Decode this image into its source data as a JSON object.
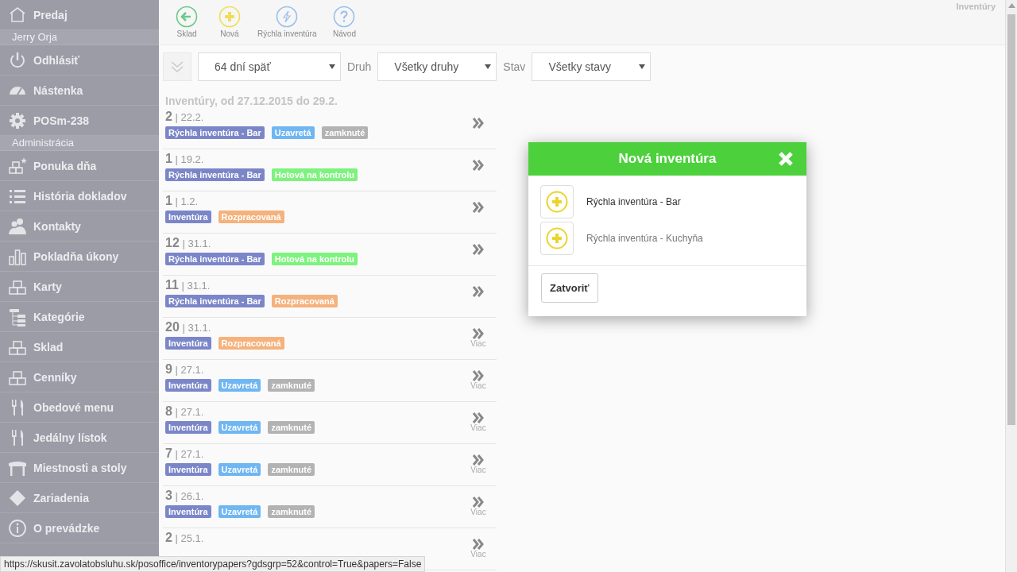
{
  "sidebar": {
    "items": [
      {
        "kind": "item",
        "label": "Predaj"
      },
      {
        "kind": "section",
        "label": "Jerry Orja"
      },
      {
        "kind": "item",
        "label": "Odhlásiť"
      },
      {
        "kind": "item",
        "label": "Nástenka"
      },
      {
        "kind": "item",
        "label": "POSm-238"
      },
      {
        "kind": "section",
        "label": "Administrácia"
      },
      {
        "kind": "item",
        "label": "Ponuka dňa"
      },
      {
        "kind": "item",
        "label": "História dokladov"
      },
      {
        "kind": "item",
        "label": "Kontakty"
      },
      {
        "kind": "item",
        "label": "Pokladňa úkony"
      },
      {
        "kind": "item",
        "label": "Karty"
      },
      {
        "kind": "item",
        "label": "Kategórie"
      },
      {
        "kind": "item",
        "label": "Sklad"
      },
      {
        "kind": "item",
        "label": "Cenníky"
      },
      {
        "kind": "item",
        "label": "Obedové menu"
      },
      {
        "kind": "item",
        "label": "Jedálny lístok"
      },
      {
        "kind": "item",
        "label": "Miestnosti a stoly"
      },
      {
        "kind": "item",
        "label": "Zariadenia"
      },
      {
        "kind": "item",
        "label": "O prevádzke"
      }
    ]
  },
  "toolbar": {
    "buttons": [
      {
        "kind": "back",
        "label": "Sklad"
      },
      {
        "kind": "add",
        "label": "Nová"
      },
      {
        "kind": "quick",
        "label": "Rýchla inventúra"
      },
      {
        "kind": "help",
        "label": "Návod"
      }
    ],
    "page_title": "Inventúry"
  },
  "filters": {
    "period": "64 dní späť",
    "type_label": "Druh",
    "type": "Všetky druhy",
    "state_label": "Stav",
    "state": "Všetky stavy"
  },
  "heading": "Inventúry, od 27.12.2015 do 29.2.",
  "rows": [
    {
      "title": "**2** | 22.2.",
      "tags": [
        {
          "text": "Rýchla inventúra - Bar",
          "color": "#7b86c9"
        },
        {
          "text": "Uzavretá",
          "color": "#6fb6f2"
        },
        {
          "text": "zamknuté",
          "color": "#b3b3b3"
        }
      ]
    },
    {
      "title": "**1** | 19.2.",
      "tags": [
        {
          "text": "Rýchla inventúra - Bar",
          "color": "#7b86c9"
        },
        {
          "text": "Hotová na kontrolu",
          "color": "#7ef27e"
        }
      ]
    },
    {
      "title": "**1** | 1.2.",
      "tags": [
        {
          "text": "Inventúra",
          "color": "#7b86c9"
        },
        {
          "text": "Rozpracovaná",
          "color": "#f5b27c"
        }
      ]
    },
    {
      "title": "**12** | 31.1.",
      "tags": [
        {
          "text": "Rýchla inventúra - Bar",
          "color": "#7b86c9"
        },
        {
          "text": "Hotová na kontrolu",
          "color": "#7ef27e"
        }
      ]
    },
    {
      "title": "**11** | 31.1.",
      "tags": [
        {
          "text": "Rýchla inventúra - Bar",
          "color": "#7b86c9"
        },
        {
          "text": "Rozpracovaná",
          "color": "#f5b27c"
        }
      ]
    },
    {
      "title": "**20** | 31.1.",
      "tags": [
        {
          "text": "Inventúra",
          "color": "#7b86c9"
        },
        {
          "text": "Rozpracovaná",
          "color": "#f5b27c"
        }
      ],
      "more": "Viac"
    },
    {
      "title": "**9** | 27.1.",
      "tags": [
        {
          "text": "Inventúra",
          "color": "#7b86c9"
        },
        {
          "text": "Uzavretá",
          "color": "#6fb6f2"
        },
        {
          "text": "zamknuté",
          "color": "#b3b3b3"
        }
      ],
      "more": "Viac"
    },
    {
      "title": "**8** | 27.1.",
      "tags": [
        {
          "text": "Inventúra",
          "color": "#7b86c9"
        },
        {
          "text": "Uzavretá",
          "color": "#6fb6f2"
        },
        {
          "text": "zamknuté",
          "color": "#b3b3b3"
        }
      ],
      "more": "Viac"
    },
    {
      "title": "**7** | 27.1.",
      "tags": [
        {
          "text": "Inventúra",
          "color": "#7b86c9"
        },
        {
          "text": "Uzavretá",
          "color": "#6fb6f2"
        },
        {
          "text": "zamknuté",
          "color": "#b3b3b3"
        }
      ],
      "more": "Viac"
    },
    {
      "title": "**3** | 26.1.",
      "tags": [
        {
          "text": "Inventúra",
          "color": "#7b86c9"
        },
        {
          "text": "Uzavretá",
          "color": "#6fb6f2"
        },
        {
          "text": "zamknuté",
          "color": "#b3b3b3"
        }
      ],
      "more": "Viac"
    },
    {
      "title": "**2** | 25.1.",
      "more": "Viac"
    }
  ],
  "dialog": {
    "title": "Nová inventúra",
    "options": [
      {
        "label": "Rýchla inventúra - Bar",
        "hovered": false
      },
      {
        "label": "Rýchla inventúra - Kuchyňa",
        "hovered": true
      }
    ],
    "close_button": "Zatvoriť"
  },
  "status_bar": "https://skusit.zavolatobsluhu.sk/posoffice/inventorypapers?gdsgrp=52&control=True&papers=False"
}
